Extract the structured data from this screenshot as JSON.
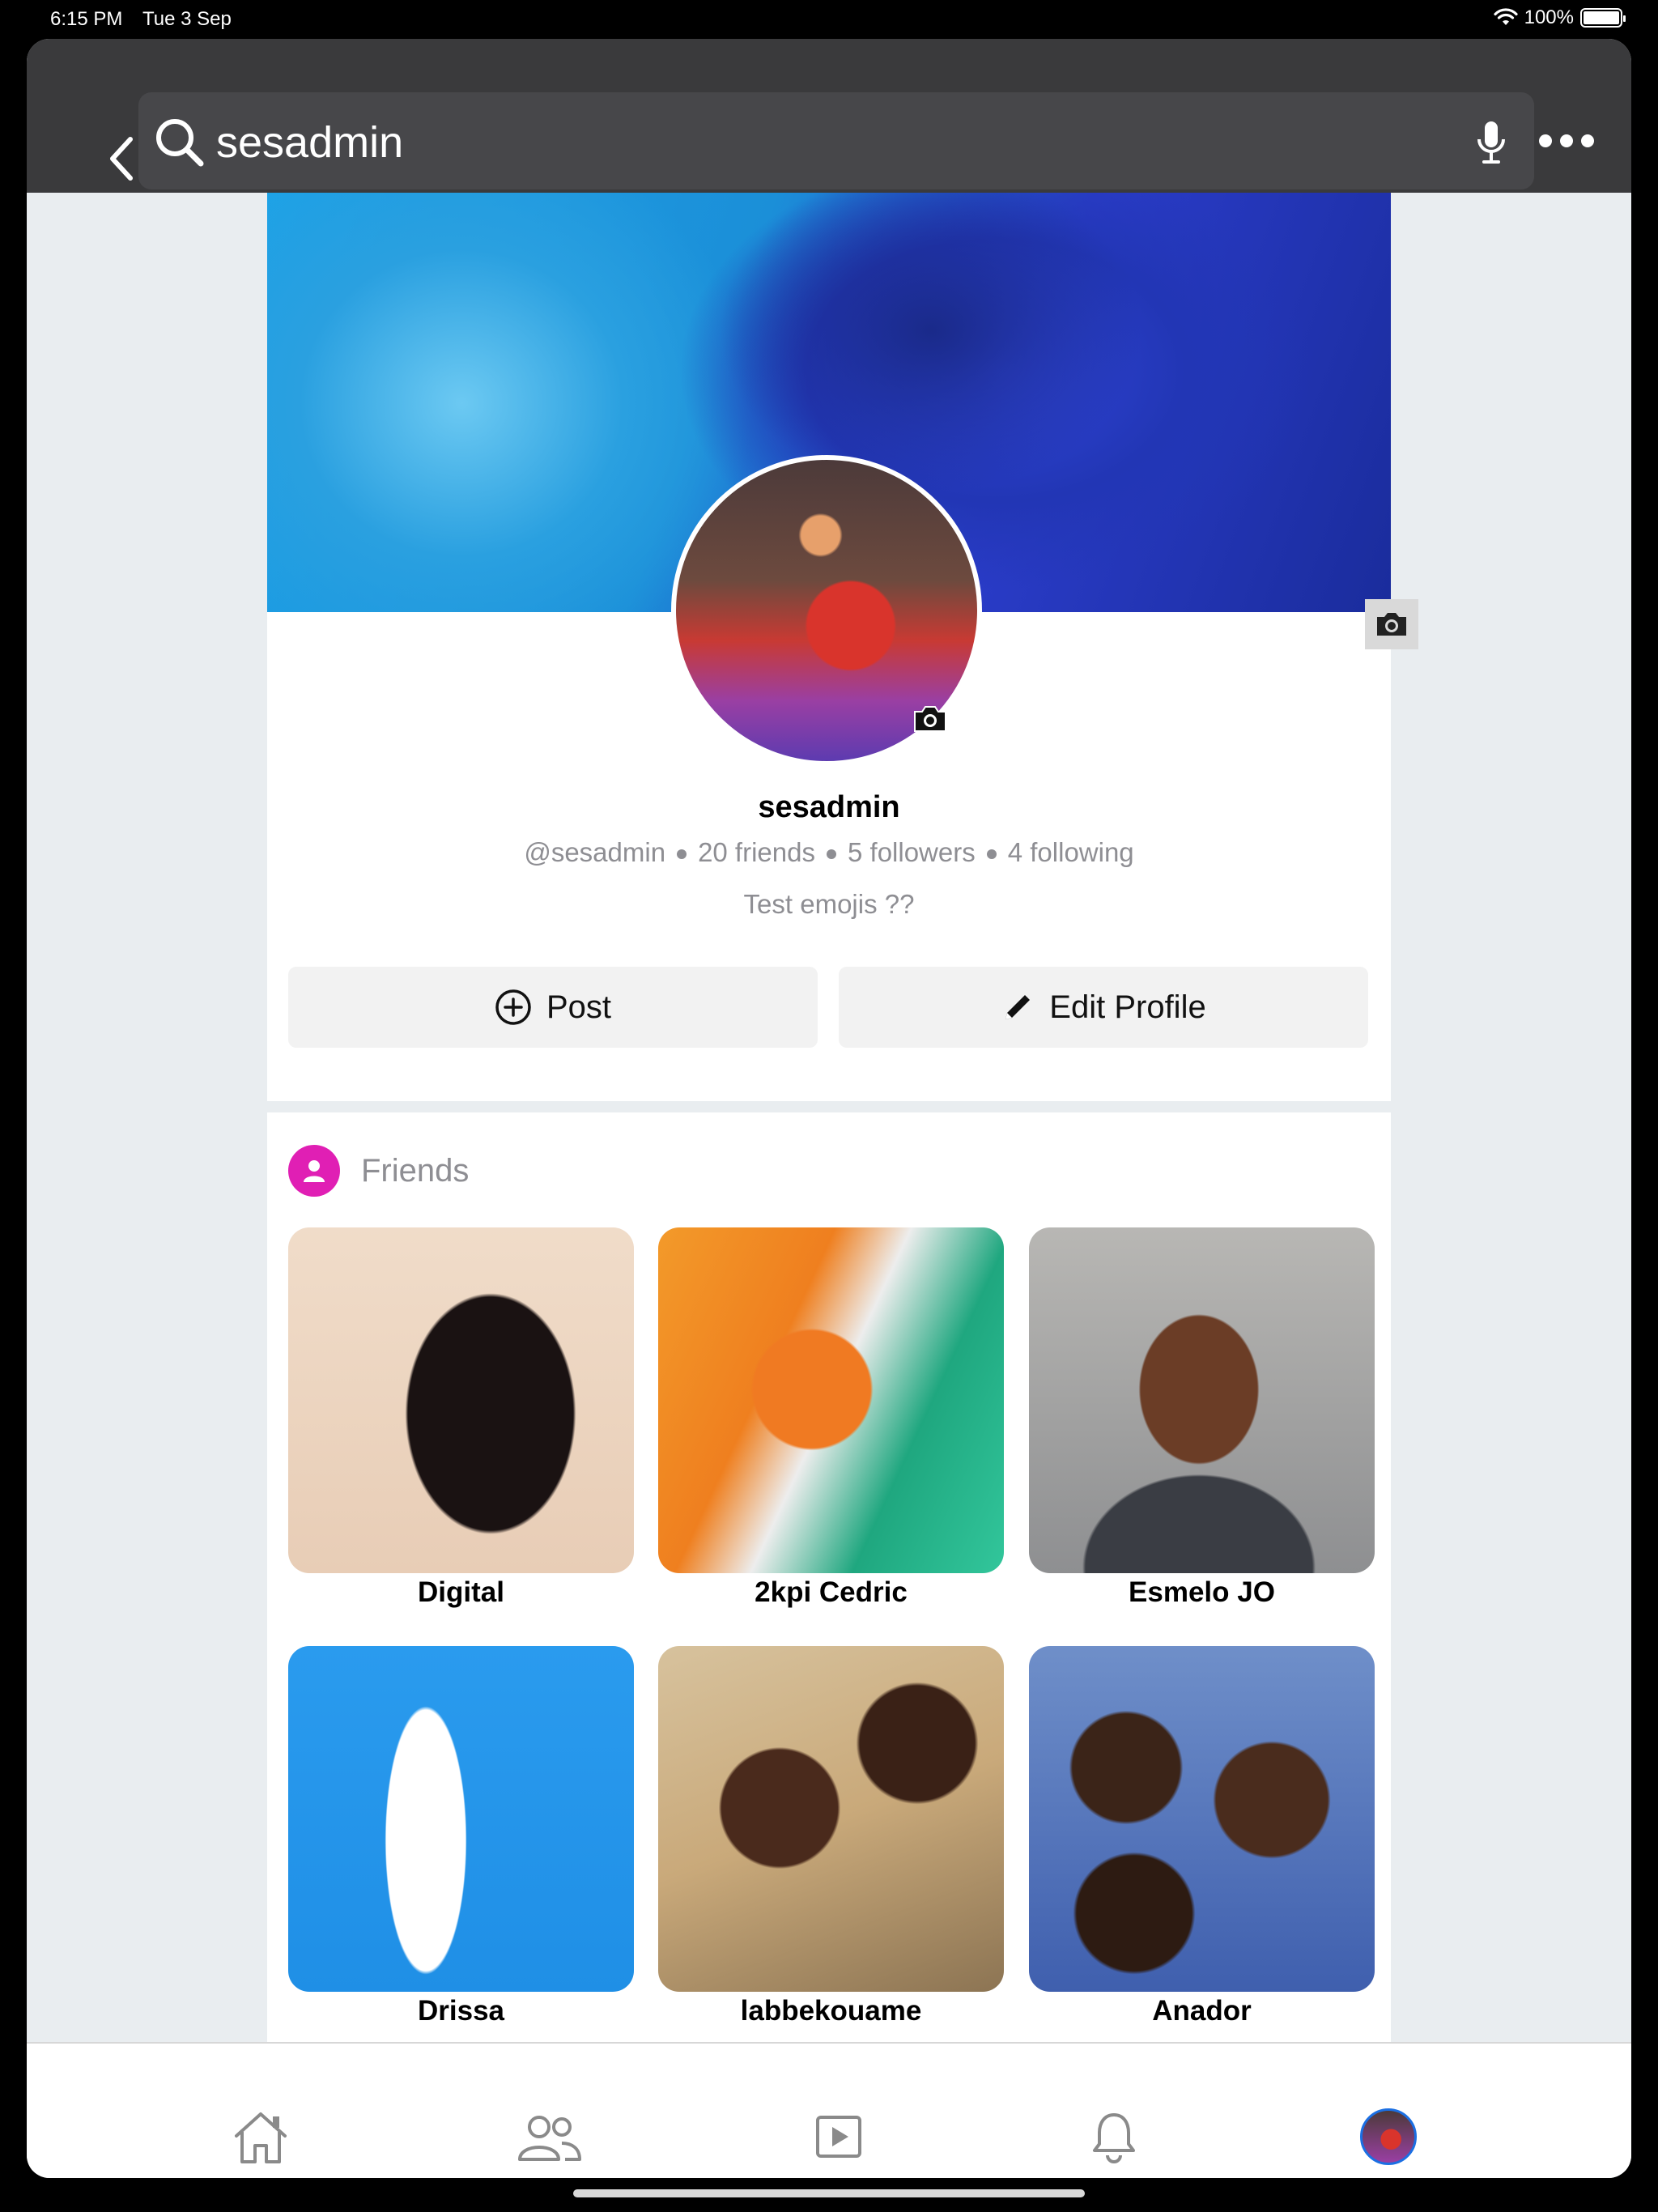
{
  "status_bar": {
    "time": "6:15 PM",
    "date": "Tue 3 Sep",
    "battery": "100%",
    "battery_level": 1.0
  },
  "search": {
    "value": "sesadmin",
    "placeholder": ""
  },
  "profile": {
    "name": "sesadmin",
    "handle": "@sesadmin",
    "friends": "20 friends",
    "followers": "5 followers",
    "following": "4 following",
    "bio": "Test emojis ??"
  },
  "actions": {
    "post_label": "Post",
    "edit_label": "Edit Profile"
  },
  "friends_section": {
    "title": "Friends",
    "accent_color": "#e01fb4",
    "items": [
      {
        "name": "Digital"
      },
      {
        "name": "2kpi Cedric"
      },
      {
        "name": "Esmelo JO"
      },
      {
        "name": "Drissa"
      },
      {
        "name": "labbekouame"
      },
      {
        "name": "Anador"
      }
    ]
  },
  "tab_bar": {
    "items": [
      "home-icon",
      "friends-icon",
      "video-icon",
      "bell-icon",
      "profile-avatar"
    ],
    "active_color": "#1b6fe3"
  }
}
